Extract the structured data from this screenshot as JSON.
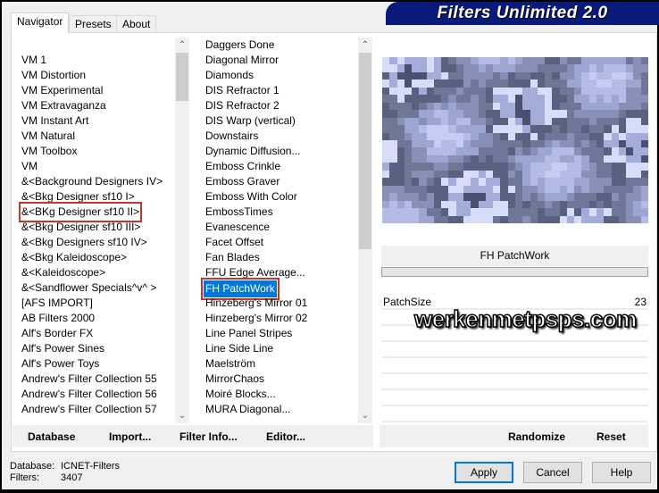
{
  "title": "Filters Unlimited 2.0",
  "tabs": [
    "Navigator",
    "Presets",
    "About"
  ],
  "categories": [
    "",
    "VM 1",
    "VM Distortion",
    "VM Experimental",
    "VM Extravaganza",
    "VM Instant Art",
    "VM Natural",
    "VM Toolbox",
    "VM",
    "&<Background Designers IV>",
    "&<Bkg Designer sf10 I>",
    "&<BKg Designer sf10 II>",
    "&<Bkg Designer sf10 III>",
    "&<Bkg Designers sf10 IV>",
    "&<Bkg Kaleidoscope>",
    "&<Kaleidoscope>",
    "&<Sandflower Specials^v^ >",
    "[AFS IMPORT]",
    "AB Filters 2000",
    "Alf's Border FX",
    "Alf's Power Sines",
    "Alf's Power Toys",
    "Andrew's Filter Collection 55",
    "Andrew's Filter Collection 56",
    "Andrew's Filter Collection 57"
  ],
  "selected_category_index": 11,
  "filters": [
    "Daggers Done",
    "Diagonal Mirror",
    "Diamonds",
    "DIS Refractor 1",
    "DIS Refractor 2",
    "DIS Warp (vertical)",
    "Downstairs",
    "Dynamic Diffusion...",
    "Emboss Crinkle",
    "Emboss Graver",
    "Emboss With Color",
    "EmbossTimes",
    "Evanescence",
    "Facet Offset",
    "Fan Blades",
    "FFU Edge Average...",
    "FH PatchWork",
    "Hinzeberg's Mirror 01",
    "Hinzeberg's Mirror 02",
    "Line Panel Stripes",
    "Line Side Line",
    "Maelström",
    "MirrorChaos",
    "Moiré Blocks...",
    "MURA Diagonal..."
  ],
  "selected_filter_index": 16,
  "filter_title": "FH PatchWork",
  "params": [
    {
      "name": "PatchSize",
      "value": "23"
    },
    {
      "name": "",
      "value": ""
    },
    {
      "name": "",
      "value": ""
    },
    {
      "name": "",
      "value": ""
    },
    {
      "name": "",
      "value": ""
    },
    {
      "name": "",
      "value": ""
    },
    {
      "name": "",
      "value": ""
    },
    {
      "name": "",
      "value": ""
    }
  ],
  "watermark": "werkenmetpsps.com",
  "toolbar": {
    "database": "Database",
    "import": "Import...",
    "filter_info": "Filter Info...",
    "editor": "Editor...",
    "randomize": "Randomize",
    "reset": "Reset"
  },
  "status": {
    "database_label": "Database:",
    "database_value": "ICNET-Filters",
    "filters_label": "Filters:",
    "filters_value": "3407"
  },
  "buttons": {
    "apply": "Apply",
    "cancel": "Cancel",
    "help": "Help"
  }
}
